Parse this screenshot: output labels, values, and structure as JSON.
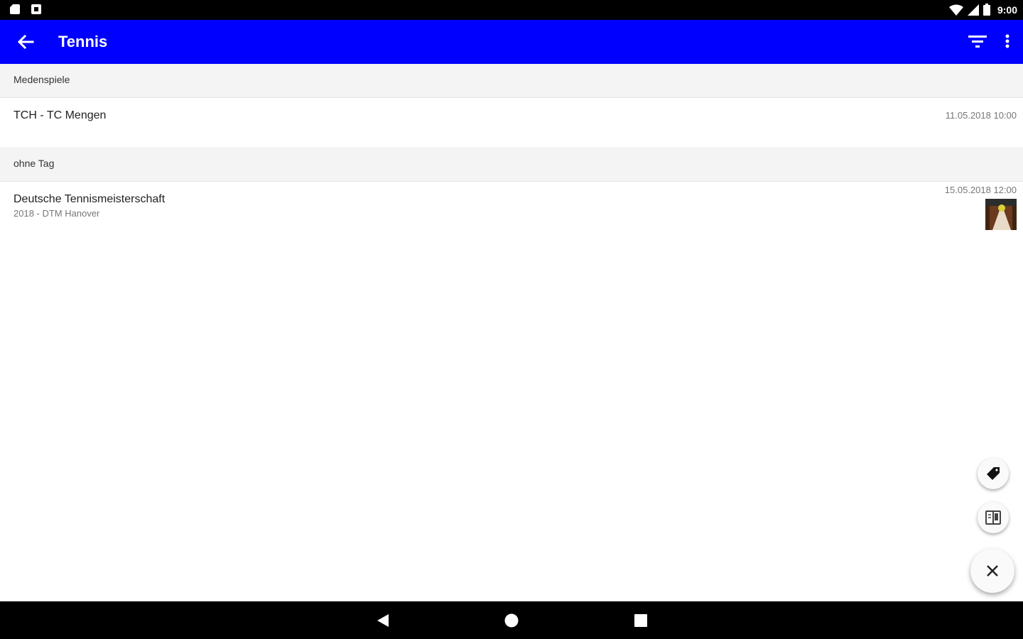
{
  "status_bar": {
    "time": "9:00",
    "icons": [
      "sd-card-icon",
      "notification-icon",
      "wifi-icon",
      "signal-icon",
      "battery-icon"
    ]
  },
  "app_bar": {
    "title": "Tennis",
    "background_color": "#0000ff",
    "icons": [
      "back-arrow-icon",
      "filter-icon",
      "more-vert-icon"
    ]
  },
  "sections": [
    {
      "header": "Medenspiele",
      "items": [
        {
          "title": "TCH - TC Mengen",
          "subtitle": "",
          "date": "11.05.2018 10:00"
        }
      ]
    },
    {
      "header": "ohne Tag",
      "items": [
        {
          "title": "Deutsche Tennismeisterschaft",
          "subtitle": "2018 - DTM Hanover",
          "date": "15.05.2018 12:00"
        }
      ]
    }
  ],
  "fabs": [
    "tag-icon",
    "book-icon",
    "close-icon"
  ],
  "nav_bar": [
    "back-triangle-icon",
    "home-circle-icon",
    "recents-square-icon"
  ]
}
